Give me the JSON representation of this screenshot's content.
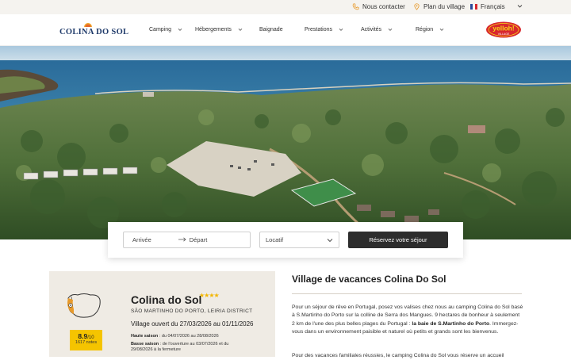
{
  "topbar": {
    "contact_label": "Nous contacter",
    "plan_label": "Plan du village",
    "language_label": "Français"
  },
  "header": {
    "logo_text": "COLINA DO SOL",
    "nav": [
      "Camping",
      "Hébergements",
      "Baignade",
      "Prestations",
      "Activités",
      "Région"
    ],
    "brand_badge": "yelloh! VILLAGE"
  },
  "booking": {
    "arrival_placeholder": "Arrivée",
    "departure_placeholder": "Départ",
    "type_value": "Locatif",
    "submit_label": "Réservez votre séjour"
  },
  "campsite": {
    "name": "Colina do Sol",
    "stars": 4,
    "stars_text": "★★★★",
    "location": "SÃO MARTINHO DO PORTO, LEIRIA DISTRICT",
    "open_text": "Village ouvert du 27/03/2026 au 01/11/2026",
    "rating_score": "8.9",
    "rating_scale": "/10",
    "rating_notes": "1617 notes",
    "seasons": {
      "high_label": "Haute saison",
      "high_value": " : du 04/07/2026 au 28/08/2026",
      "low_label": "Basse saison",
      "low_value_1": " : de l'ouverture au 03/07/2026 et du",
      "low_value_2": "29/08/2026 à la fermeture"
    }
  },
  "intro": {
    "title": "Village de vacances Colina Do Sol",
    "p1_a": "Pour un séjour de rêve en Portugal, posez vos valises chez nous au camping Colina do Sol basé à S.Martinho do Porto sur la colline de Serra dos Mangues. 9 hectares de bonheur à seulement 2 km de l'une des plus belles plages du Portugal : ",
    "p1_bold": "la baie de S.Martinho do Porto",
    "p1_b": ". Immergez-vous dans un environnement paisible et naturel où petits et grands sont les bienvenus.",
    "p2": "Pour des vacances familiales réussies, le camping Colina do Sol vous réserve un accueil"
  },
  "colors": {
    "topbar_bg": "#f5f3ef",
    "card_bg": "#efebe4",
    "rating_bg": "#f5c400",
    "button_bg": "#2d2d2d",
    "brand_red": "#d8272d",
    "brand_yellow": "#f7d417",
    "logo_blue": "#1f3a6a",
    "accent_orange": "#e89a2b"
  },
  "icons": [
    "phone-icon",
    "map-pin-icon",
    "flag-fr-icon",
    "chevron-down-icon",
    "arrow-right-icon",
    "portugal-map-icon"
  ]
}
